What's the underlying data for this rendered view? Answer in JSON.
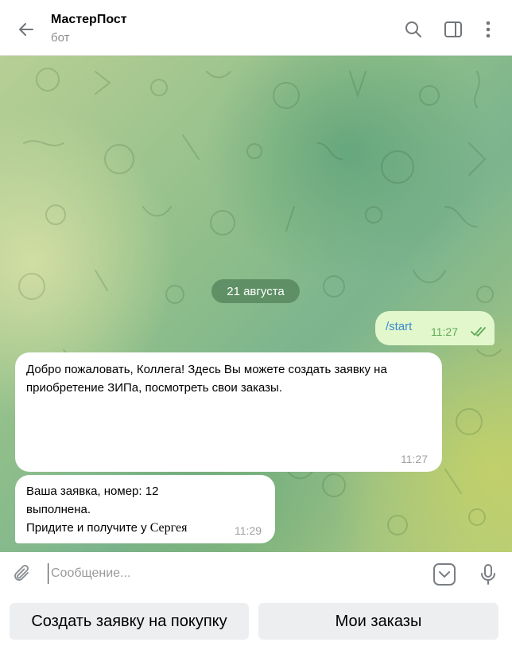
{
  "header": {
    "title": "МастерПост",
    "subtitle": "бот",
    "icons": [
      "back-arrow-icon",
      "search-icon",
      "sidebar-toggle-icon",
      "more-vertical-icon"
    ]
  },
  "chat": {
    "date": "21 августа",
    "outgoing": {
      "text": "/start",
      "time": "11:27",
      "status": "read"
    },
    "incoming": [
      {
        "text_line1": "Добро пожаловать, Коллега! Здесь Вы можете создать заявку на",
        "text_line2": "приобретение ЗИПа, посмотреть свои заказы.",
        "time": "11:27"
      },
      {
        "line1": "Ваша заявка, номер: 12",
        "line2": "выполнена.",
        "line3": "Придите и получите у",
        "signature": "Сергея",
        "time": "11:29"
      }
    ]
  },
  "composer": {
    "placeholder": "Сообщение..."
  },
  "keyboard": {
    "buttons": [
      "Создать заявку на покупку",
      "Мои заказы"
    ]
  },
  "colors": {
    "outgoing_bubble": "#e2f7cb",
    "link": "#3a8ad0",
    "date_pill": "#528258"
  }
}
